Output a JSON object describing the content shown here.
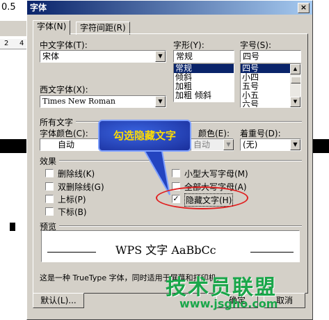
{
  "background": {
    "toolbar_value": "0.5",
    "ruler_num": "2",
    "ruler_num2": "4"
  },
  "dialog": {
    "title": "字体",
    "close": "×"
  },
  "tabs": [
    {
      "label": "字体(N)"
    },
    {
      "label": "字符间距(R)"
    }
  ],
  "chinese_font": {
    "label": "中文字体(T):",
    "value": "宋体"
  },
  "western_font": {
    "label": "西文字体(X):",
    "value": "Times New Roman"
  },
  "style": {
    "label": "字形(Y):",
    "value": "常规",
    "options": [
      "常规",
      "倾斜",
      "加粗",
      "加粗 倾斜"
    ],
    "selected": "常规"
  },
  "size": {
    "label": "字号(S):",
    "value": "四号",
    "options": [
      "四号",
      "小四",
      "五号",
      "小五",
      "六号"
    ],
    "selected": "四号"
  },
  "all_text": {
    "section_label": "所有文字",
    "color_label": "字体颜色(C):",
    "color_value": "自动",
    "underline_color_label": "颜色(E):",
    "underline_color_value": "自动",
    "emphasis_label": "着重号(D):",
    "emphasis_value": "(无)"
  },
  "effects": {
    "section_label": "效果",
    "left": [
      {
        "label": "删除线(K)",
        "checked": false
      },
      {
        "label": "双删除线(G)",
        "checked": false
      },
      {
        "label": "上标(P)",
        "checked": false
      },
      {
        "label": "下标(B)",
        "checked": false
      }
    ],
    "right": [
      {
        "label": "小型大写字母(M)",
        "checked": false
      },
      {
        "label": "全部大写字母(A)",
        "checked": false
      },
      {
        "label": "隐藏文字(H)",
        "checked": true
      }
    ]
  },
  "preview": {
    "section_label": "预览",
    "sample": "WPS 文字 AaBbCc",
    "note": "这是一种 TrueType 字体，同时适用于屏幕和打印机。"
  },
  "buttons": {
    "default": "默认(L)...",
    "ok": "确定",
    "cancel": "取消"
  },
  "annotation": {
    "callout": "勾选隐藏文字"
  },
  "watermark": {
    "brand": "技术员联盟",
    "url": "www.jsgho.com"
  }
}
